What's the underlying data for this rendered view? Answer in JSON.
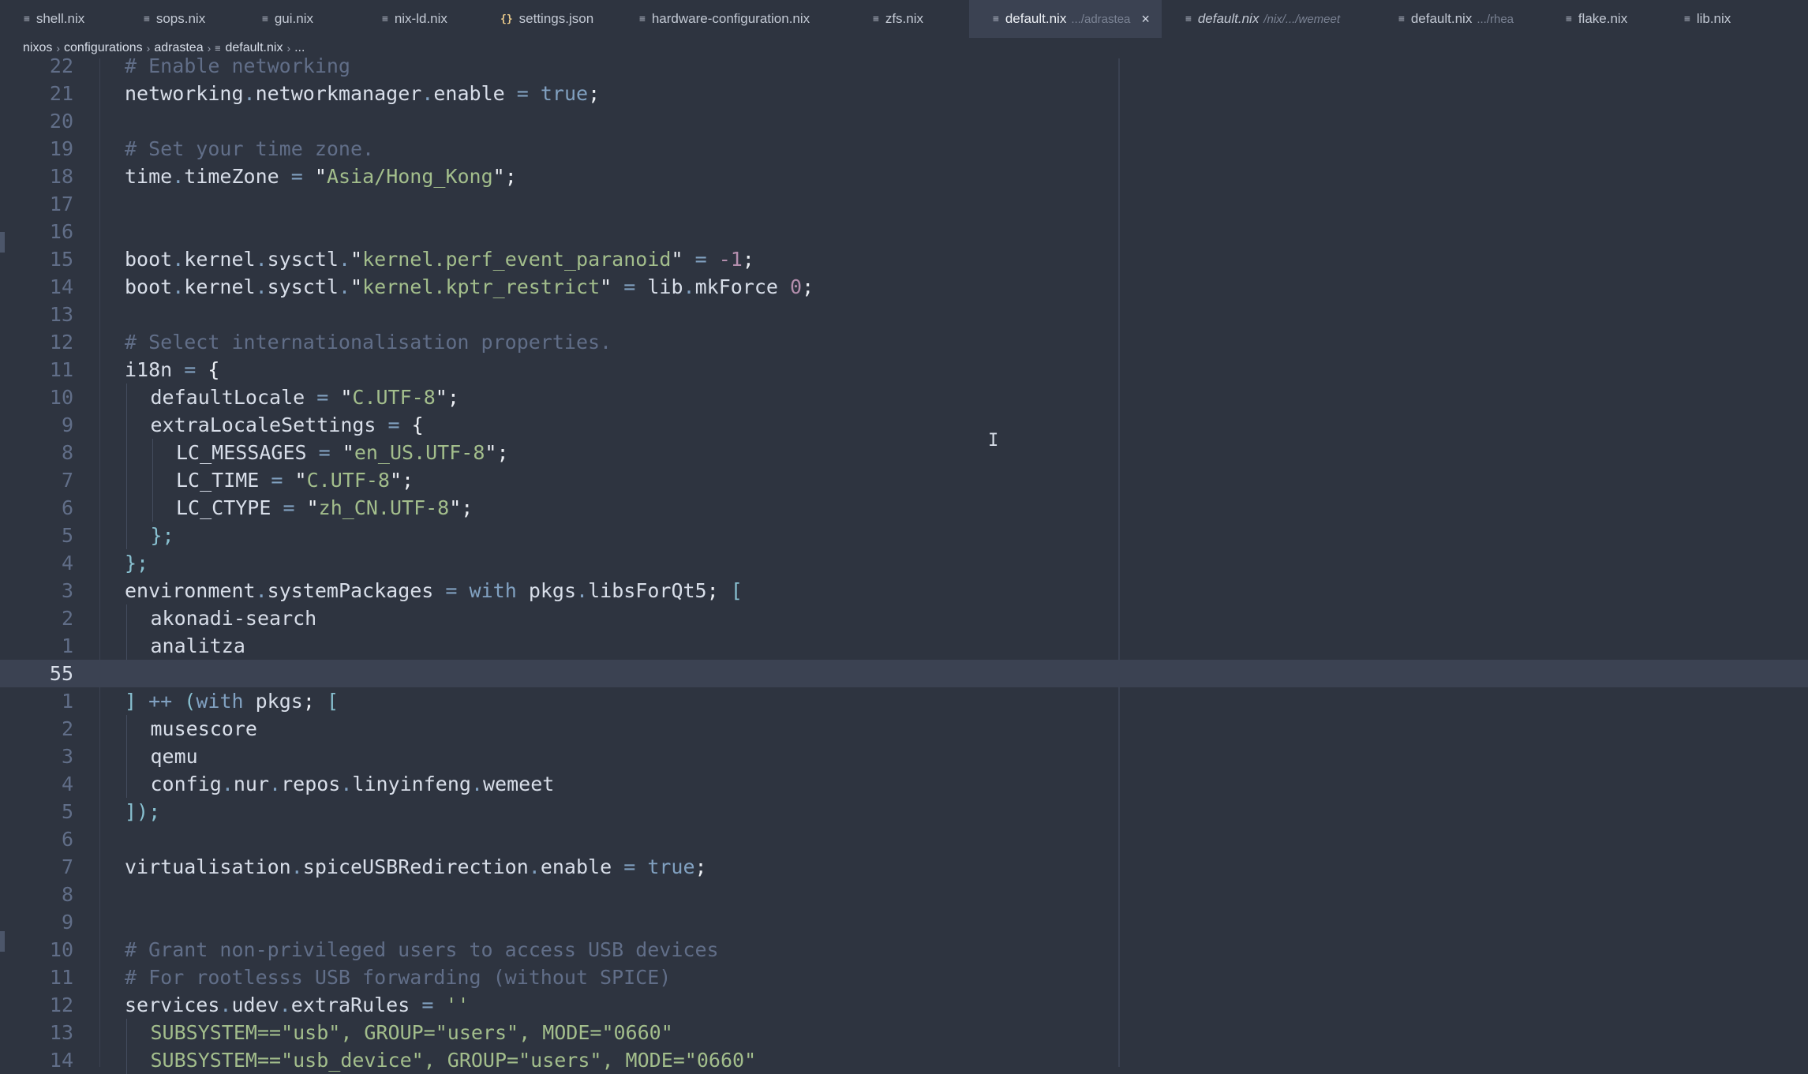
{
  "tabs": [
    {
      "label": "shell.nix",
      "icon": "nix-file-icon",
      "hint": "",
      "active": false,
      "italic": false
    },
    {
      "label": "sops.nix",
      "icon": "nix-file-icon",
      "hint": "",
      "active": false,
      "italic": false
    },
    {
      "label": "gui.nix",
      "icon": "nix-file-icon",
      "hint": "",
      "active": false,
      "italic": false
    },
    {
      "label": "nix-ld.nix",
      "icon": "nix-file-icon",
      "hint": "",
      "active": false,
      "italic": false
    },
    {
      "label": "settings.json",
      "icon": "json-file-icon",
      "hint": "",
      "active": false,
      "italic": false
    },
    {
      "label": "hardware-configuration.nix",
      "icon": "nix-file-icon",
      "hint": "",
      "active": false,
      "italic": false
    },
    {
      "label": "zfs.nix",
      "icon": "nix-file-icon",
      "hint": "",
      "active": false,
      "italic": false
    },
    {
      "label": "default.nix",
      "icon": "nix-file-icon",
      "hint": ".../adrastea",
      "active": true,
      "italic": false
    },
    {
      "label": "default.nix",
      "icon": "nix-file-icon",
      "hint": "/nix/.../wemeet",
      "active": false,
      "italic": true
    },
    {
      "label": "default.nix",
      "icon": "nix-file-icon",
      "hint": ".../rhea",
      "active": false,
      "italic": false
    },
    {
      "label": "flake.nix",
      "icon": "nix-file-icon",
      "hint": "",
      "active": false,
      "italic": false
    },
    {
      "label": "lib.nix",
      "icon": "nix-file-icon",
      "hint": "",
      "active": false,
      "italic": false
    }
  ],
  "close_glyph": "×",
  "breadcrumb": {
    "parts": [
      "nixos",
      "configurations",
      "adrastea"
    ],
    "file": "default.nix",
    "tail": "..."
  },
  "editor": {
    "current_line": "55",
    "lines": [
      {
        "num": "22",
        "indent": 0,
        "tokens": [
          [
            "c",
            "# Enable networking"
          ]
        ]
      },
      {
        "num": "21",
        "indent": 0,
        "tokens": [
          [
            "t",
            "networking"
          ],
          [
            "o",
            "."
          ],
          [
            "t",
            "networkmanager"
          ],
          [
            "o",
            "."
          ],
          [
            "t",
            "enable "
          ],
          [
            "o",
            "="
          ],
          [
            "t",
            " "
          ],
          [
            "k",
            "true"
          ],
          [
            "q",
            ";"
          ]
        ]
      },
      {
        "num": "20",
        "indent": 0,
        "tokens": []
      },
      {
        "num": "19",
        "indent": 0,
        "tokens": [
          [
            "c",
            "# Set your time zone."
          ]
        ]
      },
      {
        "num": "18",
        "indent": 0,
        "tokens": [
          [
            "t",
            "time"
          ],
          [
            "o",
            "."
          ],
          [
            "t",
            "timeZone "
          ],
          [
            "o",
            "="
          ],
          [
            "t",
            " "
          ],
          [
            "q",
            "\""
          ],
          [
            "s",
            "Asia/Hong_Kong"
          ],
          [
            "q",
            "\";"
          ]
        ]
      },
      {
        "num": "17",
        "indent": 0,
        "tokens": []
      },
      {
        "num": "16",
        "indent": 0,
        "tokens": []
      },
      {
        "num": "15",
        "indent": 0,
        "tokens": [
          [
            "t",
            "boot"
          ],
          [
            "o",
            "."
          ],
          [
            "t",
            "kernel"
          ],
          [
            "o",
            "."
          ],
          [
            "t",
            "sysctl"
          ],
          [
            "o",
            "."
          ],
          [
            "q",
            "\""
          ],
          [
            "s",
            "kernel.perf_event_paranoid"
          ],
          [
            "q",
            "\""
          ],
          [
            "t",
            " "
          ],
          [
            "o",
            "="
          ],
          [
            "t",
            " "
          ],
          [
            "n",
            "-1"
          ],
          [
            "q",
            ";"
          ]
        ]
      },
      {
        "num": "14",
        "indent": 0,
        "tokens": [
          [
            "t",
            "boot"
          ],
          [
            "o",
            "."
          ],
          [
            "t",
            "kernel"
          ],
          [
            "o",
            "."
          ],
          [
            "t",
            "sysctl"
          ],
          [
            "o",
            "."
          ],
          [
            "q",
            "\""
          ],
          [
            "s",
            "kernel.kptr_restrict"
          ],
          [
            "q",
            "\""
          ],
          [
            "t",
            " "
          ],
          [
            "o",
            "="
          ],
          [
            "t",
            " lib"
          ],
          [
            "o",
            "."
          ],
          [
            "t",
            "mkForce "
          ],
          [
            "n",
            "0"
          ],
          [
            "q",
            ";"
          ]
        ]
      },
      {
        "num": "13",
        "indent": 0,
        "tokens": []
      },
      {
        "num": "12",
        "indent": 0,
        "tokens": [
          [
            "c",
            "# Select internationalisation properties."
          ]
        ]
      },
      {
        "num": "11",
        "indent": 0,
        "tokens": [
          [
            "t",
            "i18n "
          ],
          [
            "o",
            "="
          ],
          [
            "t",
            " "
          ],
          [
            "q",
            "{"
          ]
        ]
      },
      {
        "num": "10",
        "indent": 1,
        "tokens": [
          [
            "t",
            "defaultLocale "
          ],
          [
            "o",
            "="
          ],
          [
            "t",
            " "
          ],
          [
            "q",
            "\""
          ],
          [
            "s",
            "C.UTF-8"
          ],
          [
            "q",
            "\";"
          ]
        ]
      },
      {
        "num": "9",
        "indent": 1,
        "tokens": [
          [
            "t",
            "extraLocaleSettings "
          ],
          [
            "o",
            "="
          ],
          [
            "t",
            " "
          ],
          [
            "q",
            "{"
          ]
        ]
      },
      {
        "num": "8",
        "indent": 2,
        "tokens": [
          [
            "t",
            "LC_MESSAGES "
          ],
          [
            "o",
            "="
          ],
          [
            "t",
            " "
          ],
          [
            "q",
            "\""
          ],
          [
            "s",
            "en_US.UTF-8"
          ],
          [
            "q",
            "\";"
          ]
        ]
      },
      {
        "num": "7",
        "indent": 2,
        "tokens": [
          [
            "t",
            "LC_TIME "
          ],
          [
            "o",
            "="
          ],
          [
            "t",
            " "
          ],
          [
            "q",
            "\""
          ],
          [
            "s",
            "C.UTF-8"
          ],
          [
            "q",
            "\";"
          ]
        ]
      },
      {
        "num": "6",
        "indent": 2,
        "tokens": [
          [
            "t",
            "LC_CTYPE "
          ],
          [
            "o",
            "="
          ],
          [
            "t",
            " "
          ],
          [
            "q",
            "\""
          ],
          [
            "s",
            "zh_CN.UTF-8"
          ],
          [
            "q",
            "\";"
          ]
        ]
      },
      {
        "num": "5",
        "indent": 1,
        "tokens": [
          [
            "p",
            "};"
          ]
        ]
      },
      {
        "num": "4",
        "indent": 0,
        "tokens": [
          [
            "p",
            "};"
          ]
        ]
      },
      {
        "num": "3",
        "indent": 0,
        "tokens": [
          [
            "t",
            "environment"
          ],
          [
            "o",
            "."
          ],
          [
            "t",
            "systemPackages "
          ],
          [
            "o",
            "="
          ],
          [
            "t",
            " "
          ],
          [
            "k",
            "with"
          ],
          [
            "t",
            " pkgs"
          ],
          [
            "o",
            "."
          ],
          [
            "t",
            "libsForQt5"
          ],
          [
            "q",
            ";"
          ],
          [
            "t",
            " "
          ],
          [
            "p",
            "["
          ]
        ]
      },
      {
        "num": "2",
        "indent": 1,
        "tokens": [
          [
            "t",
            "akonadi-search"
          ]
        ]
      },
      {
        "num": "1",
        "indent": 1,
        "tokens": [
          [
            "t",
            "analitza"
          ]
        ]
      },
      {
        "num": "55",
        "indent": 0,
        "tokens": [],
        "current": true
      },
      {
        "num": "1",
        "indent": 0,
        "tokens": [
          [
            "p",
            "]"
          ],
          [
            "t",
            " "
          ],
          [
            "o",
            "++"
          ],
          [
            "t",
            " "
          ],
          [
            "p",
            "("
          ],
          [
            "k",
            "with"
          ],
          [
            "t",
            " pkgs"
          ],
          [
            "q",
            ";"
          ],
          [
            "t",
            " "
          ],
          [
            "p",
            "["
          ]
        ]
      },
      {
        "num": "2",
        "indent": 1,
        "tokens": [
          [
            "t",
            "musescore"
          ]
        ]
      },
      {
        "num": "3",
        "indent": 1,
        "tokens": [
          [
            "t",
            "qemu"
          ]
        ]
      },
      {
        "num": "4",
        "indent": 1,
        "tokens": [
          [
            "t",
            "config"
          ],
          [
            "o",
            "."
          ],
          [
            "t",
            "nur"
          ],
          [
            "o",
            "."
          ],
          [
            "t",
            "repos"
          ],
          [
            "o",
            "."
          ],
          [
            "t",
            "linyinfeng"
          ],
          [
            "o",
            "."
          ],
          [
            "t",
            "wemeet"
          ]
        ]
      },
      {
        "num": "5",
        "indent": 0,
        "tokens": [
          [
            "p",
            "]);"
          ]
        ]
      },
      {
        "num": "6",
        "indent": 0,
        "tokens": []
      },
      {
        "num": "7",
        "indent": 0,
        "tokens": [
          [
            "t",
            "virtualisation"
          ],
          [
            "o",
            "."
          ],
          [
            "t",
            "spiceUSBRedirection"
          ],
          [
            "o",
            "."
          ],
          [
            "t",
            "enable "
          ],
          [
            "o",
            "="
          ],
          [
            "t",
            " "
          ],
          [
            "k",
            "true"
          ],
          [
            "q",
            ";"
          ]
        ]
      },
      {
        "num": "8",
        "indent": 0,
        "tokens": []
      },
      {
        "num": "9",
        "indent": 0,
        "tokens": []
      },
      {
        "num": "10",
        "indent": 0,
        "tokens": [
          [
            "c",
            "# Grant non-privileged users to access USB devices"
          ]
        ]
      },
      {
        "num": "11",
        "indent": 0,
        "tokens": [
          [
            "c",
            "# For rootlesss USB forwarding (without SPICE)"
          ]
        ]
      },
      {
        "num": "12",
        "indent": 0,
        "tokens": [
          [
            "t",
            "services"
          ],
          [
            "o",
            "."
          ],
          [
            "t",
            "udev"
          ],
          [
            "o",
            "."
          ],
          [
            "t",
            "extraRules "
          ],
          [
            "o",
            "="
          ],
          [
            "t",
            " "
          ],
          [
            "s",
            "''"
          ]
        ]
      },
      {
        "num": "13",
        "indent": 1,
        "tokens": [
          [
            "s",
            "SUBSYSTEM==\"usb\", GROUP=\"users\", MODE=\"0660\""
          ]
        ]
      },
      {
        "num": "14",
        "indent": 1,
        "tokens": [
          [
            "s",
            "SUBSYSTEM==\"usb_device\", GROUP=\"users\", MODE=\"0660\""
          ]
        ]
      }
    ]
  },
  "colors": {
    "background": "#2e3440",
    "current_line": "#3b4252",
    "comment": "#616e88",
    "string": "#a3be8c",
    "keyword": "#81a1c1",
    "number": "#b48ead",
    "text": "#d8dee9"
  }
}
